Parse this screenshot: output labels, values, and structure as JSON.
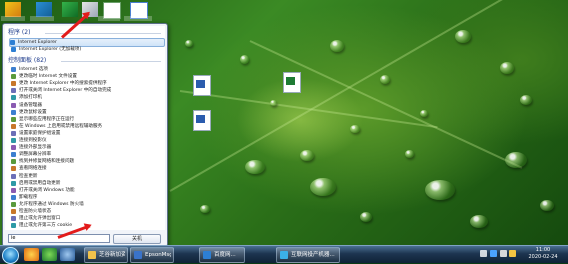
{
  "desktop": {
    "icons": [
      {
        "label": "",
        "kind": "excel"
      },
      {
        "label": "",
        "kind": "word"
      },
      {
        "label": "",
        "kind": "word"
      }
    ],
    "top_strip_icons": [
      "app-icon",
      "app-icon",
      "app-icon",
      "app-icon",
      "excel-icon",
      "word-icon"
    ]
  },
  "start_menu": {
    "sections": {
      "programs": "程序 (2)",
      "control_panel": "控制面板 (82)"
    },
    "program_items": [
      {
        "label": "Internet Explorer",
        "icon": "ie-icon",
        "selected": true
      },
      {
        "label": "Internet Explorer (无加载项)",
        "icon": "ie-icon",
        "selected": false
      }
    ],
    "control_panel_items": [
      {
        "label": "Internet 选项",
        "icon": "internet-options-icon"
      },
      {
        "label": "更改临时 Internet 文件设置",
        "icon": "settings-icon"
      },
      {
        "label": "更改 Internet Explorer 中的搜索提供程序",
        "icon": "settings-icon"
      },
      {
        "label": "打开或关闭 Internet Explorer 中的自动完成",
        "icon": "settings-icon"
      },
      {
        "label": "添加打印机",
        "icon": "printer-icon"
      },
      {
        "label": "设备管理器",
        "icon": "device-manager-icon"
      },
      {
        "label": "更改鼠标设置",
        "icon": "mouse-icon"
      },
      {
        "label": "显示哪些应用程序正在运行",
        "icon": "settings-icon"
      },
      {
        "label": "在 Windows 上启用或禁用远程辅助服务",
        "icon": "remote-icon"
      },
      {
        "label": "设置家庭保护组设置",
        "icon": "settings-icon"
      },
      {
        "label": "连接到投影仪",
        "icon": "projector-icon"
      },
      {
        "label": "连接外部显示器",
        "icon": "display-icon"
      },
      {
        "label": "调整屏幕分辨率",
        "icon": "display-icon"
      },
      {
        "label": "找到并修复网络和连接问题",
        "icon": "network-icon"
      },
      {
        "label": "查看网络连接",
        "icon": "network-icon"
      },
      {
        "label": "检查更新",
        "icon": "update-icon"
      },
      {
        "label": "启用或禁用自动更新",
        "icon": "update-icon"
      },
      {
        "label": "打开或关闭 Windows 功能",
        "icon": "features-icon"
      },
      {
        "label": "卸载程序",
        "icon": "uninstall-icon"
      },
      {
        "label": "允许程序通过 Windows 防火墙",
        "icon": "firewall-icon"
      },
      {
        "label": "检查防火墙状态",
        "icon": "firewall-icon"
      },
      {
        "label": "阻止或允许弹出窗口",
        "icon": "popup-icon"
      },
      {
        "label": "阻止或允许第三方 cookie",
        "icon": "cookie-icon"
      }
    ],
    "search": {
      "value": "ie",
      "placeholder": ""
    },
    "shutdown_label": "关机"
  },
  "taskbar": {
    "pinned": [
      "browser-icon",
      "media-icon",
      "app-icon"
    ],
    "buttons": [
      {
        "label": "芝谷新加资源...",
        "icon": "folder-icon"
      },
      {
        "label": "EpsonMsg",
        "icon": "epson-icon"
      },
      {
        "label": "百度网...",
        "icon": "browser-icon"
      },
      {
        "label": "互联网投产机器...",
        "icon": "app-icon"
      }
    ],
    "clock": {
      "time": "11:00",
      "date": "2020-02-24"
    }
  },
  "colors": {
    "accent": "#1e3c8c",
    "arrow": "#e31b1b",
    "taskbar": "#1d3550"
  }
}
